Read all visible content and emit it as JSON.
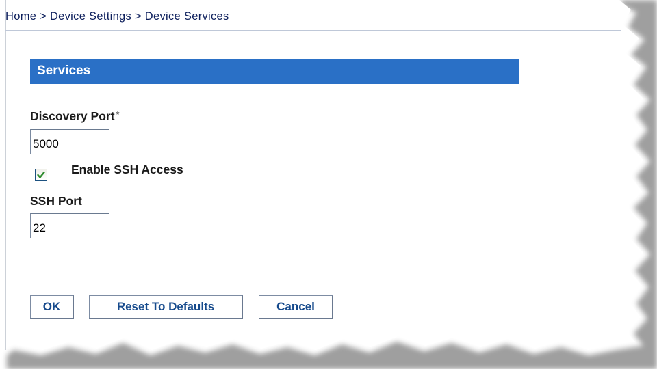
{
  "breadcrumb": {
    "home": "Home",
    "separator": ">",
    "device_settings": "Device Settings",
    "current": "Device Services"
  },
  "section": {
    "title": "Services"
  },
  "discovery_port": {
    "label": "Discovery Port",
    "required_mark": "*",
    "value": "5000"
  },
  "ssh_access": {
    "label": "Enable SSH Access",
    "checked": true
  },
  "ssh_port": {
    "label": "SSH Port",
    "value": "22"
  },
  "buttons": {
    "ok": "OK",
    "reset": "Reset To Defaults",
    "cancel": "Cancel"
  },
  "colors": {
    "header_bar": "#2a70c6",
    "button_text": "#164a8c",
    "check_mark": "#2e8b2e"
  }
}
